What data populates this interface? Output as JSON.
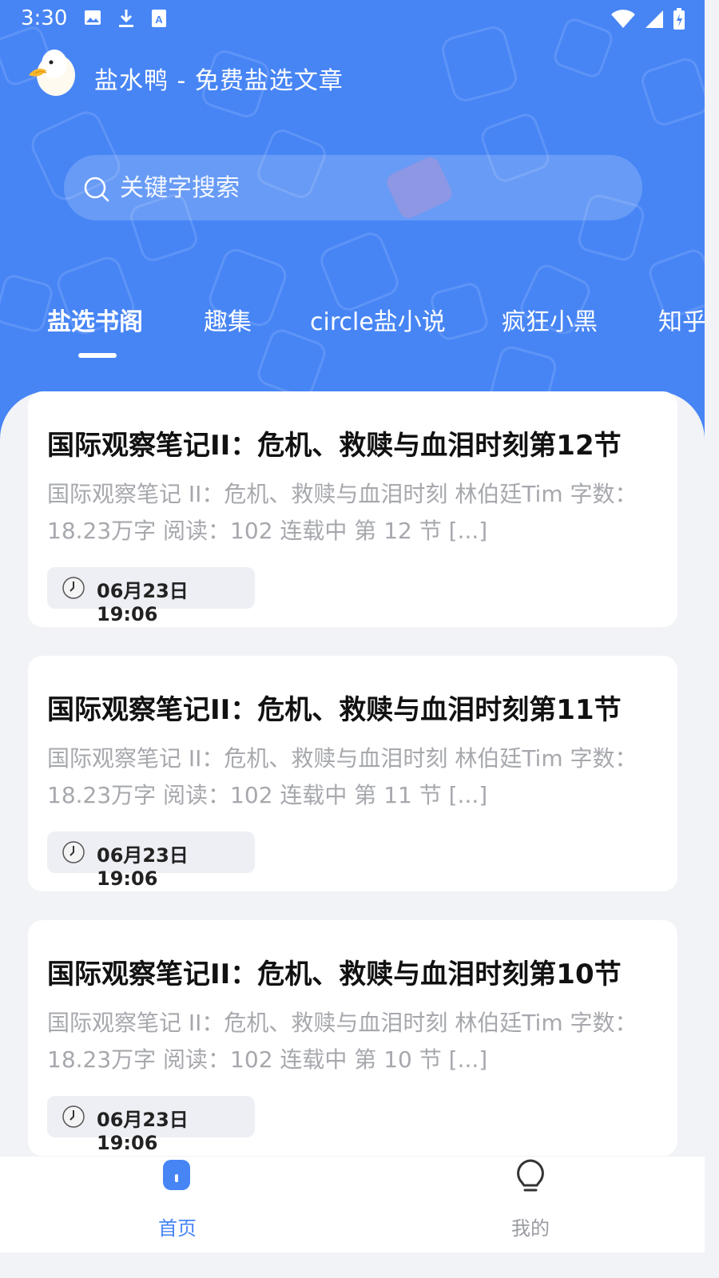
{
  "status_bar": {
    "time": "3:30",
    "left_icons": [
      "image-icon",
      "download-icon",
      "translate-icon"
    ],
    "right_icons": [
      "wifi-icon",
      "signal-icon",
      "battery-icon"
    ]
  },
  "app": {
    "title": "盐水鸭 - 免费盐选文章"
  },
  "search": {
    "placeholder": "关键字搜索"
  },
  "tabs": [
    {
      "label": "盐选书阁",
      "active": true
    },
    {
      "label": "趣集",
      "active": false
    },
    {
      "label": "circle盐小说",
      "active": false
    },
    {
      "label": "疯狂小黑",
      "active": false
    },
    {
      "label": "知乎",
      "active": false
    }
  ],
  "articles": [
    {
      "title": "国际观察笔记II：危机、救赎与血泪时刻第12节",
      "desc": "国际观察笔记 II：危机、救赎与血泪时刻 林伯廷Tim 字数：18.23万字 阅读：102 连载中 第 12 节 [...]",
      "time": "06月23日 19:06"
    },
    {
      "title": "国际观察笔记II：危机、救赎与血泪时刻第11节",
      "desc": "国际观察笔记 II：危机、救赎与血泪时刻 林伯廷Tim 字数：18.23万字 阅读：102 连载中 第 11 节 [...]",
      "time": "06月23日 19:06"
    },
    {
      "title": "国际观察笔记II：危机、救赎与血泪时刻第10节",
      "desc": "国际观察笔记 II：危机、救赎与血泪时刻 林伯廷Tim 字数：18.23万字 阅读：102 连载中 第 10 节 [...]",
      "time": "06月23日 19:06"
    }
  ],
  "bottom_nav": [
    {
      "label": "首页",
      "icon": "home-icon",
      "active": true
    },
    {
      "label": "我的",
      "icon": "profile-icon",
      "active": false
    }
  ],
  "colors": {
    "brand": "#4785f5",
    "title_text": "#111111",
    "desc_text": "#a6a8ad",
    "inactive_nav": "#9a9ca2"
  }
}
